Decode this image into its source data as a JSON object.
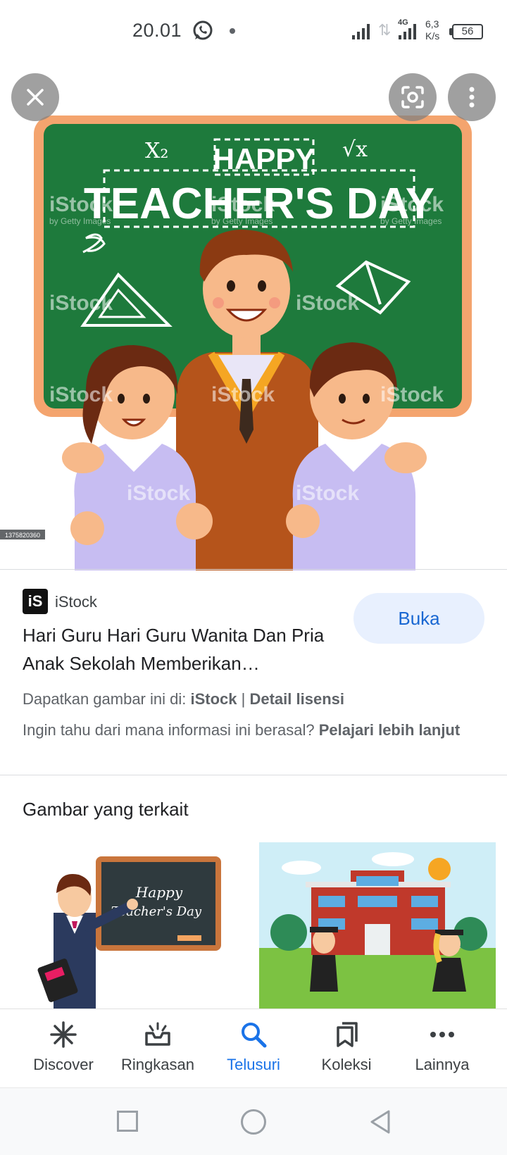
{
  "status_bar": {
    "time": "20.01",
    "network_type": "4G",
    "net_speed_value": "6,3",
    "net_speed_unit": "K/s",
    "battery_level": "56"
  },
  "hero": {
    "banner_line1": "HAPPY",
    "banner_line2": "TEACHER'S DAY",
    "formula_left": "X₂",
    "formula_right": "√x",
    "watermark": "iStock",
    "watermark_sub": "by Getty Images",
    "image_id": "1375820360"
  },
  "result": {
    "source_logo": "iS",
    "source_name": "iStock",
    "open_label": "Buka",
    "title": "Hari Guru Hari Guru Wanita Dan Pria Anak Sekolah Memberikan…",
    "license_prefix": "Dapatkan gambar ini di:",
    "license_source": "iStock",
    "license_separator": "|",
    "license_link": "Detail lisensi",
    "info_prefix": "Ingin tahu dari mana informasi ini berasal?",
    "info_link": "Pelajari lebih lanjut"
  },
  "related": {
    "heading": "Gambar yang terkait",
    "item1_board_text_1": "Happy",
    "item1_board_text_2": "Teacher's Day"
  },
  "bottom_nav": {
    "items": [
      {
        "label": "Discover",
        "icon": "asterisk-icon"
      },
      {
        "label": "Ringkasan",
        "icon": "inbox-icon"
      },
      {
        "label": "Telusuri",
        "icon": "search-icon"
      },
      {
        "label": "Koleksi",
        "icon": "bookmark-icon"
      },
      {
        "label": "Lainnya",
        "icon": "more-horizontal-icon"
      }
    ],
    "active": "Telusuri"
  },
  "colors": {
    "accent": "#1a73e8",
    "button_bg": "#e8f0fe",
    "chalkboard": "#1e7a3c",
    "board_frame": "#f4a46e"
  }
}
